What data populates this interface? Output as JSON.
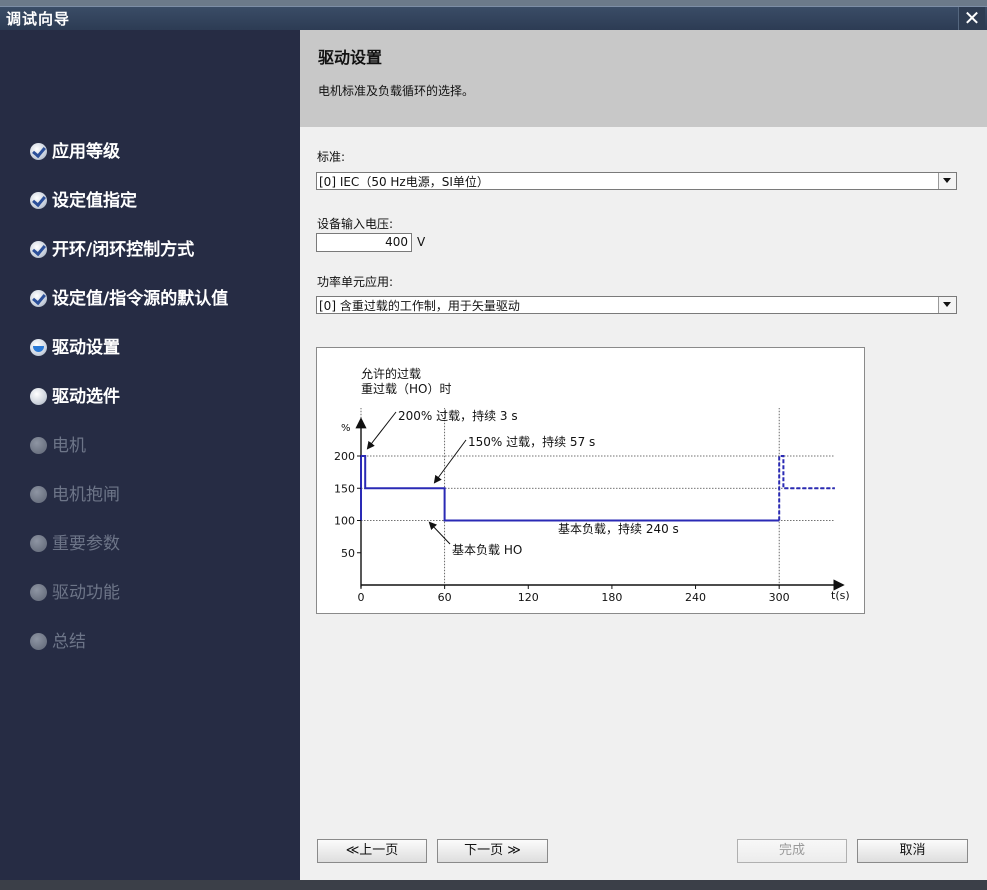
{
  "window": {
    "title": "调试向导",
    "close_glyph": "✕"
  },
  "sidebar": {
    "items": [
      {
        "label": "应用等级",
        "state": "done"
      },
      {
        "label": "设定值指定",
        "state": "done"
      },
      {
        "label": "开环/闭环控制方式",
        "state": "done"
      },
      {
        "label": "设定值/指令源的默认值",
        "state": "done"
      },
      {
        "label": "驱动设置",
        "state": "active"
      },
      {
        "label": "驱动选件",
        "state": "available"
      },
      {
        "label": "电机",
        "state": "disabled"
      },
      {
        "label": "电机抱闸",
        "state": "disabled"
      },
      {
        "label": "重要参数",
        "state": "disabled"
      },
      {
        "label": "驱动功能",
        "state": "disabled"
      },
      {
        "label": "总结",
        "state": "disabled"
      }
    ]
  },
  "header": {
    "title": "驱动设置",
    "subtitle": "电机标准及负载循环的选择。"
  },
  "form": {
    "standard_label": "标准:",
    "standard_value": "[0] IEC（50 Hz电源，SI单位）",
    "voltage_label": "设备输入电压:",
    "voltage_value": "400",
    "voltage_unit": "V",
    "power_label": "功率单元应用:",
    "power_value": "[0] 含重过载的工作制，用于矢量驱动"
  },
  "chart_data": {
    "type": "line",
    "title_line1": "允许的过载",
    "title_line2": "重过载（HO）时",
    "ylabel": "%",
    "xlabel": "t(s)",
    "x_ticks": [
      0,
      60,
      120,
      180,
      240,
      300
    ],
    "y_ticks": [
      50,
      100,
      150,
      200
    ],
    "annotations": {
      "peak": "200% 过载，持续 3 s",
      "over150": "150% 过载，持续 57 s",
      "base": "基本负载，持续 240 s",
      "baseho": "基本负载 HO"
    },
    "series": [
      {
        "x": [
          0,
          0,
          3,
          3,
          60,
          60,
          300
        ],
        "y": [
          100,
          200,
          200,
          150,
          150,
          100,
          100
        ],
        "style": "solid"
      },
      {
        "x": [
          300,
          300,
          303,
          303,
          340
        ],
        "y": [
          100,
          200,
          200,
          150,
          150
        ],
        "style": "dashed"
      }
    ],
    "line_color": "#2a2ab5"
  },
  "buttons": {
    "prev": "≪上一页",
    "next": "下一页 ≫",
    "finish": "完成",
    "cancel": "取消"
  }
}
